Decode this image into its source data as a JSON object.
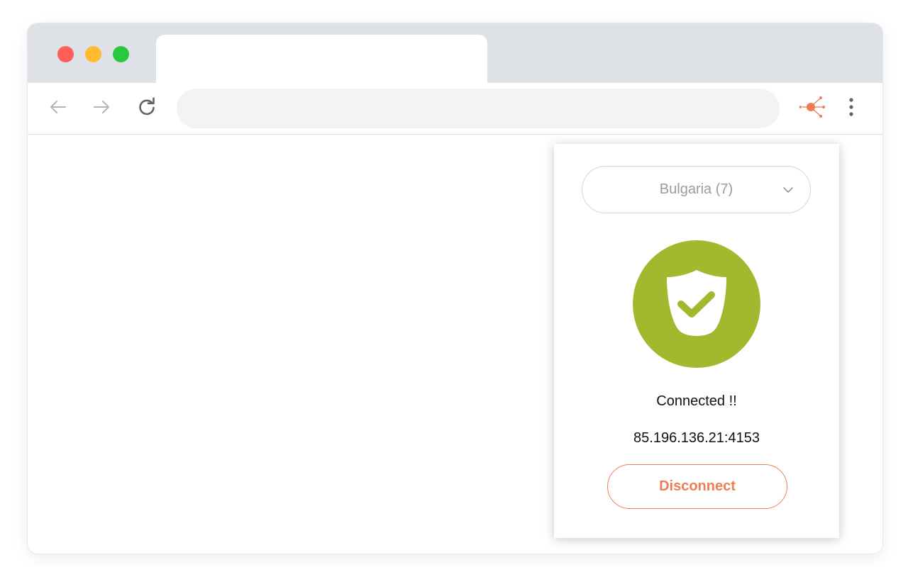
{
  "window": {
    "traffic_lights": {
      "close_color": "#ff5f57",
      "minimize_color": "#febc2e",
      "maximize_color": "#28c840"
    }
  },
  "toolbar": {
    "back_icon": "arrow-left-icon",
    "forward_icon": "arrow-right-icon",
    "reload_icon": "reload-icon",
    "address_value": "",
    "extension_icon": "proxy-network-icon",
    "menu_icon": "kebab-menu-icon"
  },
  "popup": {
    "country_select": {
      "selected": "Bulgaria (7)"
    },
    "status": {
      "icon": "shield-check-icon",
      "color": "#a3b82f",
      "text": "Connected !!"
    },
    "address": "85.196.136.21:4153",
    "disconnect_label": "Disconnect",
    "accent_color": "#ef7d53"
  }
}
